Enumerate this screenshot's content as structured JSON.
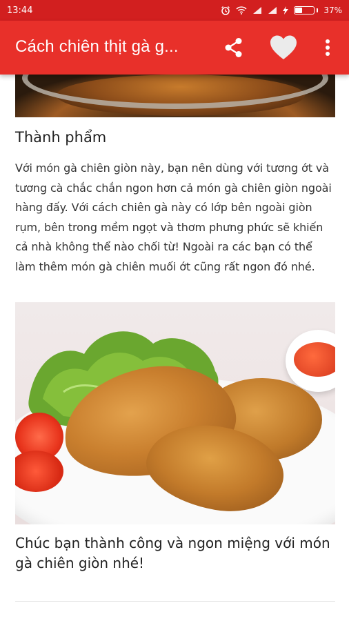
{
  "status_bar": {
    "time": "13:44",
    "battery_percent_label": "37%",
    "battery_level": 0.37
  },
  "app_bar": {
    "title": "Cách chiên thịt gà g...",
    "share_icon": "share-icon",
    "favorite_icon": "heart-icon",
    "more_icon": "more-vert-icon"
  },
  "article": {
    "section_title": "Thành phẩm",
    "body": "Với món gà chiên giòn này, bạn nên dùng với tương ớt và tương cà chắc chắn ngon hơn cả món gà chiên giòn ngoài hàng đấy. Với cách chiên gà này có lớp bên ngoài giòn rụm, bên trong mềm ngọt và thơm phưng phức sẽ khiến cả nhà không thể nào chối từ! Ngoài ra các bạn có thể làm thêm món gà chiên muối ớt cũng rất ngon đó nhé.",
    "closing": "Chúc bạn thành công và ngon miệng với món gà chiên giòn nhé!"
  },
  "colors": {
    "status_bar": "#d21f1f",
    "app_bar": "#e8302a"
  }
}
